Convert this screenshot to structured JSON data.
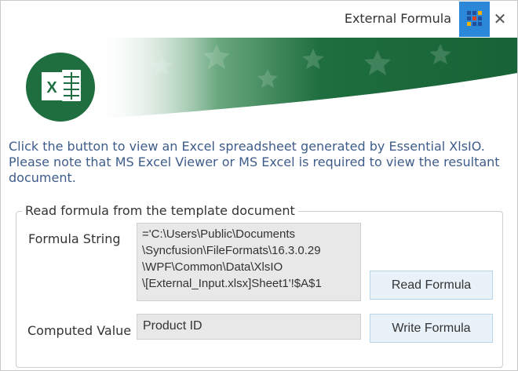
{
  "window": {
    "title": "External Formula",
    "app_icon": "grid-app-icon",
    "close_glyph": "✕"
  },
  "banner": {
    "logo_letter": "X",
    "accent_color": "#1e6e3f"
  },
  "description": {
    "line1": "Click the button to view an Excel spreadsheet generated by Essential XlsIO.",
    "line2": "Please note that MS Excel Viewer or MS Excel is required to view the resultant",
    "line3": "document."
  },
  "group": {
    "legend": "Read formula from the template document",
    "formula_label": "Formula String",
    "formula_value": "='C:\\Users\\Public\\Documents\n\\Syncfusion\\FileFormats\\16.3.0.29\n\\WPF\\Common\\Data\\XlsIO\n\\[External_Input.xlsx]Sheet1'!$A$1",
    "read_button": "Read Formula",
    "computed_label": "Computed Value",
    "computed_value": "Product ID",
    "write_button": "Write Formula"
  }
}
